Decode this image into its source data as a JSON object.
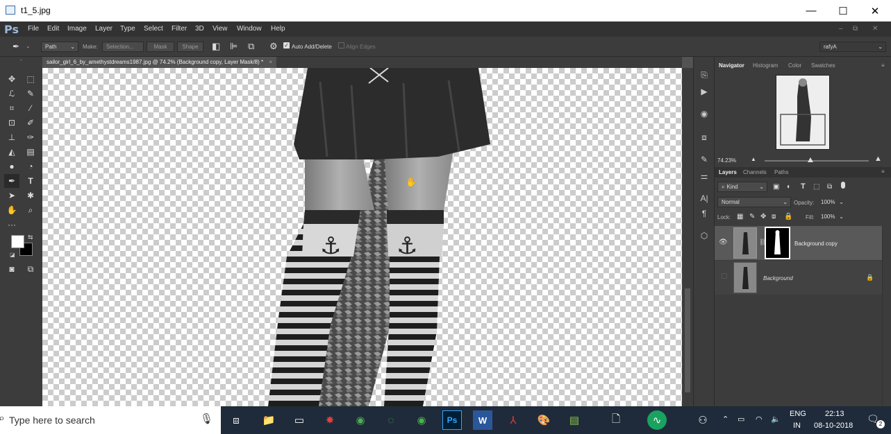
{
  "window": {
    "title": "t1_5.jpg",
    "minimize": "—",
    "maximize": "☐",
    "close": "✕"
  },
  "menu": {
    "logo": "Ps",
    "items": [
      "File",
      "Edit",
      "Image",
      "Layer",
      "Type",
      "Select",
      "Filter",
      "3D",
      "View",
      "Window",
      "Help"
    ],
    "doc_controls": [
      "–",
      "⧉",
      "✕"
    ]
  },
  "options": {
    "mode": "Path",
    "make_label": "Make:",
    "selection": "Selection...",
    "mask": "Mask",
    "shape": "Shape",
    "auto_add_delete": "Auto Add/Delete",
    "align_edges": "Align Edges",
    "workspace": "rafyA"
  },
  "document": {
    "tab_title": "sailor_girl_6_by_amethystdreams1987.jpg @ 74.2% (Background copy, Layer Mask/8) *"
  },
  "navigator": {
    "tabs": [
      "Navigator",
      "Histogram",
      "Color",
      "Swatches"
    ],
    "zoom": "74.23%"
  },
  "layers_panel": {
    "tabs": [
      "Layers",
      "Channels",
      "Paths"
    ],
    "kind": "Kind",
    "blend": "Normal",
    "opacity_label": "Opacity:",
    "opacity": "100%",
    "lock_label": "Lock:",
    "fill_label": "Fill:",
    "fill": "100%",
    "layers": [
      {
        "name": "Background copy"
      },
      {
        "name": "Background"
      }
    ]
  },
  "taskbar": {
    "search_placeholder": "Type here to search",
    "lang_top": "ENG",
    "lang_bottom": "IN",
    "time": "22:13",
    "date": "08-10-2018",
    "notifications": "2"
  }
}
